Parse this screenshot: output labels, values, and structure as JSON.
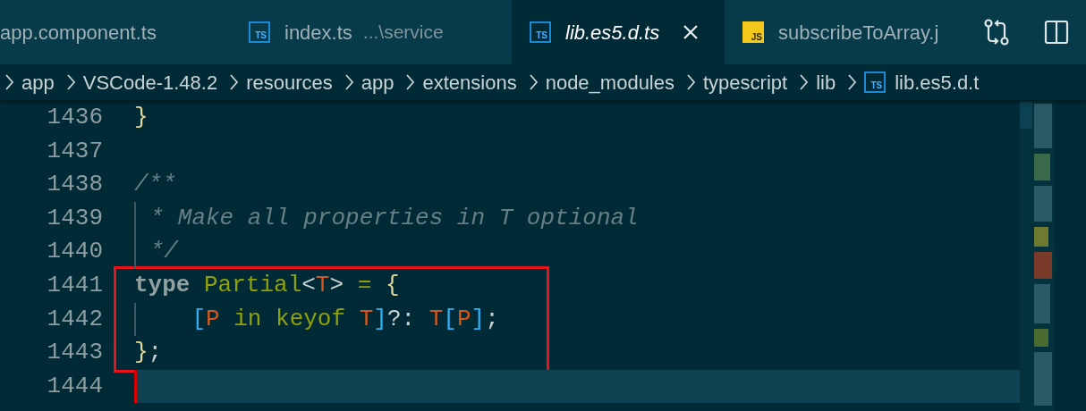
{
  "tabs": [
    {
      "label": "app.component.ts",
      "selected": false,
      "preview": false
    },
    {
      "label": "index.ts",
      "description": "...\\service",
      "icon": {
        "kind": "ts",
        "label": "TS"
      },
      "selected": false,
      "preview": false
    },
    {
      "label": "lib.es5.d.ts",
      "icon": {
        "kind": "ts",
        "label": "TS"
      },
      "selected": true,
      "preview": true
    },
    {
      "label": "subscribeToArray.j",
      "icon": {
        "kind": "js",
        "label": "JS"
      },
      "selected": false,
      "preview": false
    }
  ],
  "toolbar": [
    {
      "kind": "compare"
    },
    {
      "kind": "split"
    }
  ],
  "breadcrumb": [
    {
      "label": "app"
    },
    {
      "label": "VSCode-1.48.2"
    },
    {
      "label": "resources"
    },
    {
      "label": "app"
    },
    {
      "label": "extensions"
    },
    {
      "label": "node_modules"
    },
    {
      "label": "typescript"
    },
    {
      "label": "lib"
    },
    {
      "label": "lib.es5.d.t",
      "icon": {
        "kind": "ts",
        "label": "TS"
      }
    }
  ],
  "editor": {
    "lines": [
      {
        "number": "1436",
        "tokens": [
          {
            "kind": "brace",
            "text": "}"
          }
        ],
        "indent_guide": false,
        "boxed": false,
        "current": false
      },
      {
        "number": "1437",
        "indent_guide": false,
        "boxed": false,
        "current": false
      },
      {
        "number": "1438",
        "tokens": [
          {
            "kind": "comment",
            "text": "/**"
          }
        ],
        "indent_guide": false,
        "boxed": false,
        "current": false
      },
      {
        "number": "1439",
        "tokens": [
          {
            "kind": "comment",
            "text": " * Make all properties in T optional"
          }
        ],
        "indent_guide": true,
        "boxed": false,
        "current": false
      },
      {
        "number": "1440",
        "tokens": [
          {
            "kind": "comment",
            "text": " */"
          }
        ],
        "indent_guide": true,
        "boxed": false,
        "current": false
      },
      {
        "number": "1441",
        "tokens": [
          {
            "kind": "keyword",
            "text": "type "
          },
          {
            "kind": "type",
            "text": "Partial"
          },
          {
            "kind": "punct",
            "text": "<"
          },
          {
            "kind": "typeparam",
            "text": "T"
          },
          {
            "kind": "punct",
            "text": "> "
          },
          {
            "kind": "operator",
            "text": "= "
          },
          {
            "kind": "brace",
            "text": "{"
          }
        ],
        "indent_guide": false,
        "boxed": true,
        "current": false
      },
      {
        "number": "1442",
        "tokens": [
          {
            "kind": "bracket",
            "text": "    ["
          },
          {
            "kind": "typeparam",
            "text": "P"
          },
          {
            "kind": "operator",
            "text": " in keyof "
          },
          {
            "kind": "typeparam",
            "text": "T"
          },
          {
            "kind": "bracket",
            "text": "]"
          },
          {
            "kind": "punct",
            "text": "?: "
          },
          {
            "kind": "typeparam",
            "text": "T"
          },
          {
            "kind": "bracket",
            "text": "["
          },
          {
            "kind": "typeparam",
            "text": "P"
          },
          {
            "kind": "bracket",
            "text": "]"
          },
          {
            "kind": "punct",
            "text": ";"
          }
        ],
        "indent_guide": true,
        "boxed": true,
        "current": false
      },
      {
        "number": "1443",
        "tokens": [
          {
            "kind": "brace",
            "text": "}"
          },
          {
            "kind": "punct",
            "text": ";"
          }
        ],
        "indent_guide": false,
        "boxed": true,
        "current": false
      },
      {
        "number": "1444",
        "indent_guide": false,
        "boxed": false,
        "current": true
      }
    ]
  }
}
